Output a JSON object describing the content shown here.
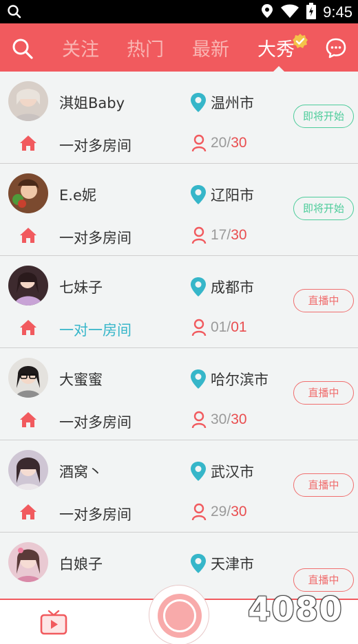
{
  "status_bar": {
    "time": "9:45"
  },
  "app_bar": {
    "tabs": [
      {
        "label": "关注"
      },
      {
        "label": "热门"
      },
      {
        "label": "最新"
      },
      {
        "label": "大秀"
      }
    ],
    "active_tab": "大秀"
  },
  "rooms": [
    {
      "name": "淇姐Baby",
      "city": "温州市",
      "room_type": "一对多房间",
      "current": "20",
      "max": "30",
      "status": "即将开始",
      "status_kind": "soon"
    },
    {
      "name": "E.e妮",
      "city": "辽阳市",
      "room_type": "一对多房间",
      "current": "17",
      "max": "30",
      "status": "即将开始",
      "status_kind": "soon"
    },
    {
      "name": "七妹子",
      "city": "成都市",
      "room_type": "一对一房间",
      "current": "01",
      "max": "01",
      "status": "直播中",
      "status_kind": "live"
    },
    {
      "name": "大蜜蜜",
      "city": "哈尔滨市",
      "room_type": "一对多房间",
      "current": "30",
      "max": "30",
      "status": "直播中",
      "status_kind": "live"
    },
    {
      "name": "酒窝丶",
      "city": "武汉市",
      "room_type": "一对多房间",
      "current": "29",
      "max": "30",
      "status": "直播中",
      "status_kind": "live"
    },
    {
      "name": "白娘子",
      "city": "天津市",
      "status": "直播中",
      "status_kind": "live"
    }
  ],
  "count_separator": "/",
  "watermark": "4080",
  "colors": {
    "accent": "#f15a5e",
    "location": "#36b6c9",
    "soon": "#4ccc9a",
    "live": "#f06e6e"
  },
  "icons": [
    "search-icon",
    "wifi-icon",
    "battery-icon",
    "location-pin-icon",
    "home-icon",
    "person-icon",
    "chat-icon",
    "tv-icon",
    "verified-badge-icon"
  ]
}
